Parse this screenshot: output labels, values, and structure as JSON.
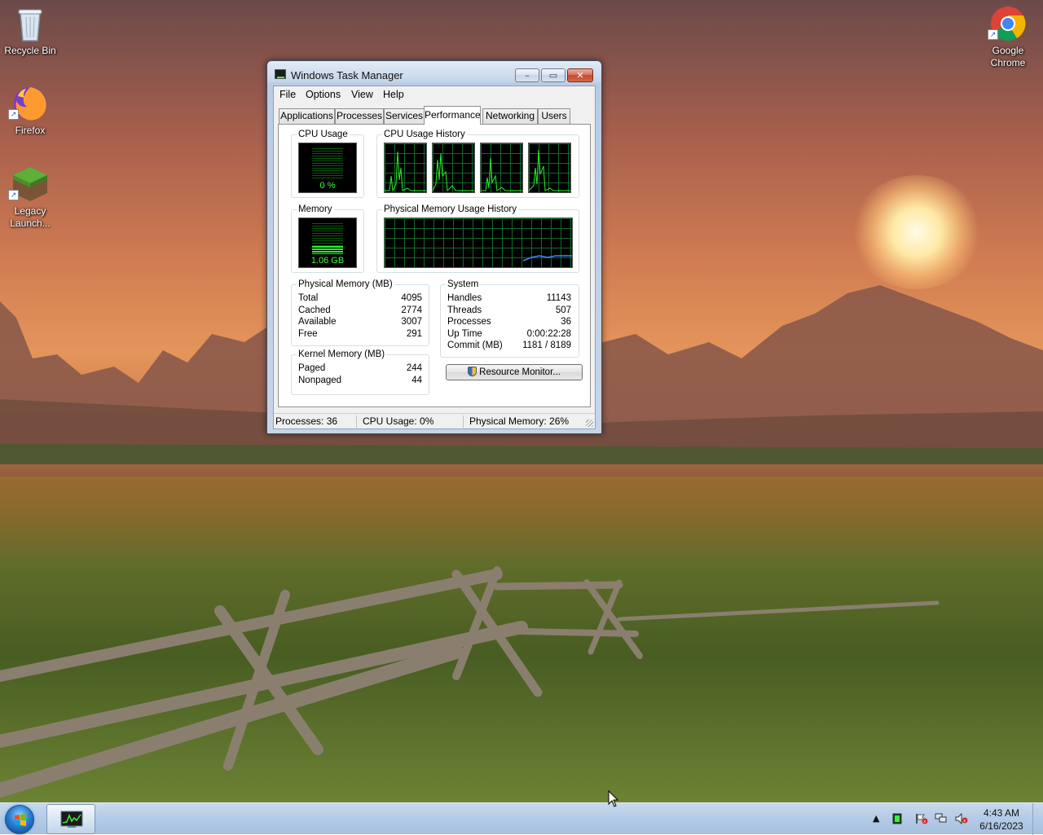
{
  "desktop": {
    "icons": [
      {
        "label": "Recycle Bin",
        "icon": "recycle-bin-icon"
      },
      {
        "label": "Firefox",
        "icon": "firefox-icon"
      },
      {
        "label": "Legacy Launch...",
        "icon": "minecraft-icon"
      },
      {
        "label": "Google Chrome",
        "icon": "chrome-icon"
      }
    ]
  },
  "window": {
    "title": "Windows Task Manager",
    "caption_buttons": {
      "minimize": "–",
      "maximize": "▭",
      "close": "✕"
    },
    "menu": [
      "File",
      "Options",
      "View",
      "Help"
    ],
    "tabs": [
      "Applications",
      "Processes",
      "Services",
      "Performance",
      "Networking",
      "Users"
    ],
    "active_tab": "Performance",
    "performance": {
      "cpu_usage_label": "CPU Usage",
      "cpu_usage_value": "0 %",
      "cpu_usage_fraction": 0.0,
      "cpu_history_label": "CPU Usage History",
      "memory_label": "Memory",
      "memory_value": "1.06 GB",
      "memory_fraction": 0.26,
      "memory_history_label": "Physical Memory Usage History",
      "physical_memory": {
        "label": "Physical Memory (MB)",
        "rows": [
          {
            "name": "Total",
            "value": "4095"
          },
          {
            "name": "Cached",
            "value": "2774"
          },
          {
            "name": "Available",
            "value": "3007"
          },
          {
            "name": "Free",
            "value": "291"
          }
        ]
      },
      "kernel_memory": {
        "label": "Kernel Memory (MB)",
        "rows": [
          {
            "name": "Paged",
            "value": "244"
          },
          {
            "name": "Nonpaged",
            "value": "44"
          }
        ]
      },
      "system": {
        "label": "System",
        "rows": [
          {
            "name": "Handles",
            "value": "11143"
          },
          {
            "name": "Threads",
            "value": "507"
          },
          {
            "name": "Processes",
            "value": "36"
          },
          {
            "name": "Up Time",
            "value": "0:00:22:28"
          },
          {
            "name": "Commit (MB)",
            "value": "1181 / 8189"
          }
        ]
      },
      "resource_monitor_button": "Resource Monitor..."
    },
    "statusbar": {
      "processes": "Processes: 36",
      "cpu": "CPU Usage: 0%",
      "memory": "Physical Memory: 26%"
    }
  },
  "taskbar": {
    "clock_time": "4:43 AM",
    "clock_date": "6/16/2023",
    "tray_icons": [
      "show-hidden-icons-icon",
      "task-manager-tray-icon",
      "action-center-icon",
      "network-icon",
      "volume-muted-icon"
    ]
  },
  "colors": {
    "graph_line": "#27f027",
    "graph_grid": "#0f6a2a",
    "memory_line": "#3c8cff",
    "taskbar": "#b3cbe6"
  }
}
